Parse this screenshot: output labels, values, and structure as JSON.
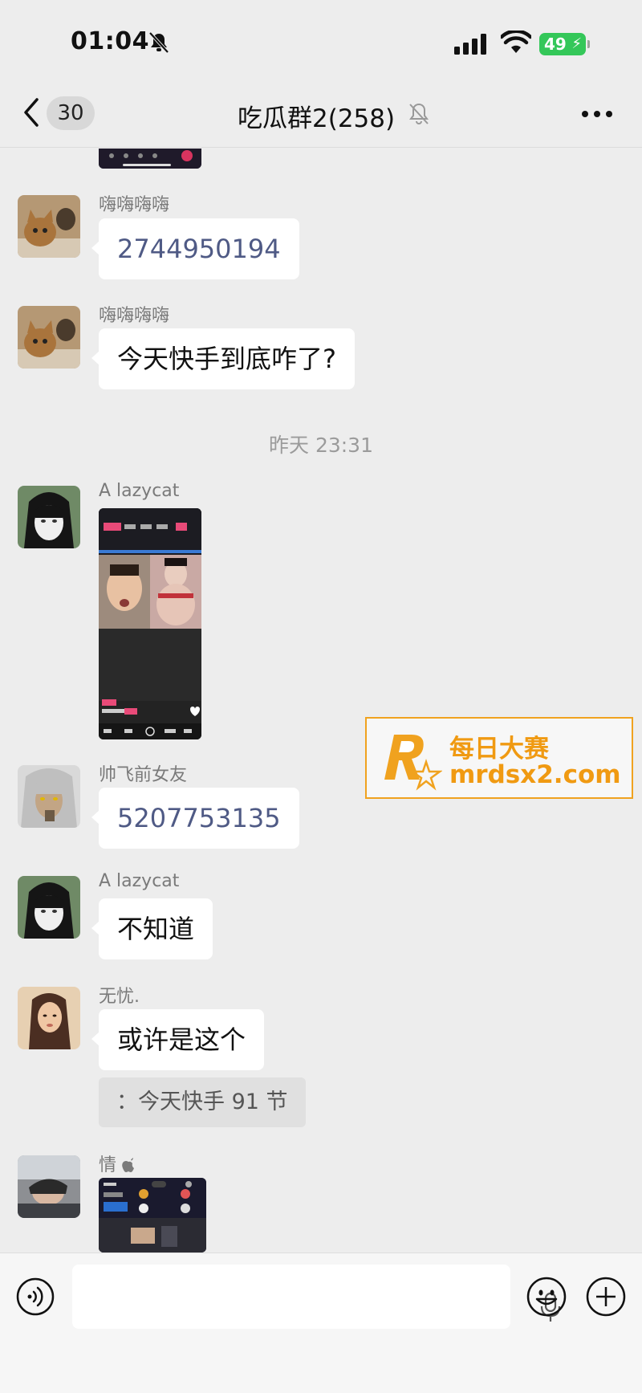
{
  "status_bar": {
    "time": "01:04",
    "battery": "49"
  },
  "nav": {
    "back_count": "30",
    "title": "吃瓜群2(258)"
  },
  "messages": [
    {
      "sender": "嗨嗨嗨嗨",
      "text": "2744950194"
    },
    {
      "sender": "嗨嗨嗨嗨",
      "text": "今天快手到底咋了?"
    },
    {
      "timestamp": "昨天 23:31"
    },
    {
      "sender": "A lazycat"
    },
    {
      "sender": "帅飞前女友",
      "text": "5207753135"
    },
    {
      "sender": "A lazycat",
      "text": "不知道"
    },
    {
      "sender": "无忧.",
      "text": "或许是这个",
      "quote": "：今天快手 91 节"
    },
    {
      "sender": "情"
    }
  ],
  "watermark": {
    "title": "每日大赛",
    "url": "mrdsx2.com"
  },
  "colors": {
    "accent_battery": "#34c759",
    "number_link": "#4f5a85",
    "watermark": "#f09a12"
  }
}
